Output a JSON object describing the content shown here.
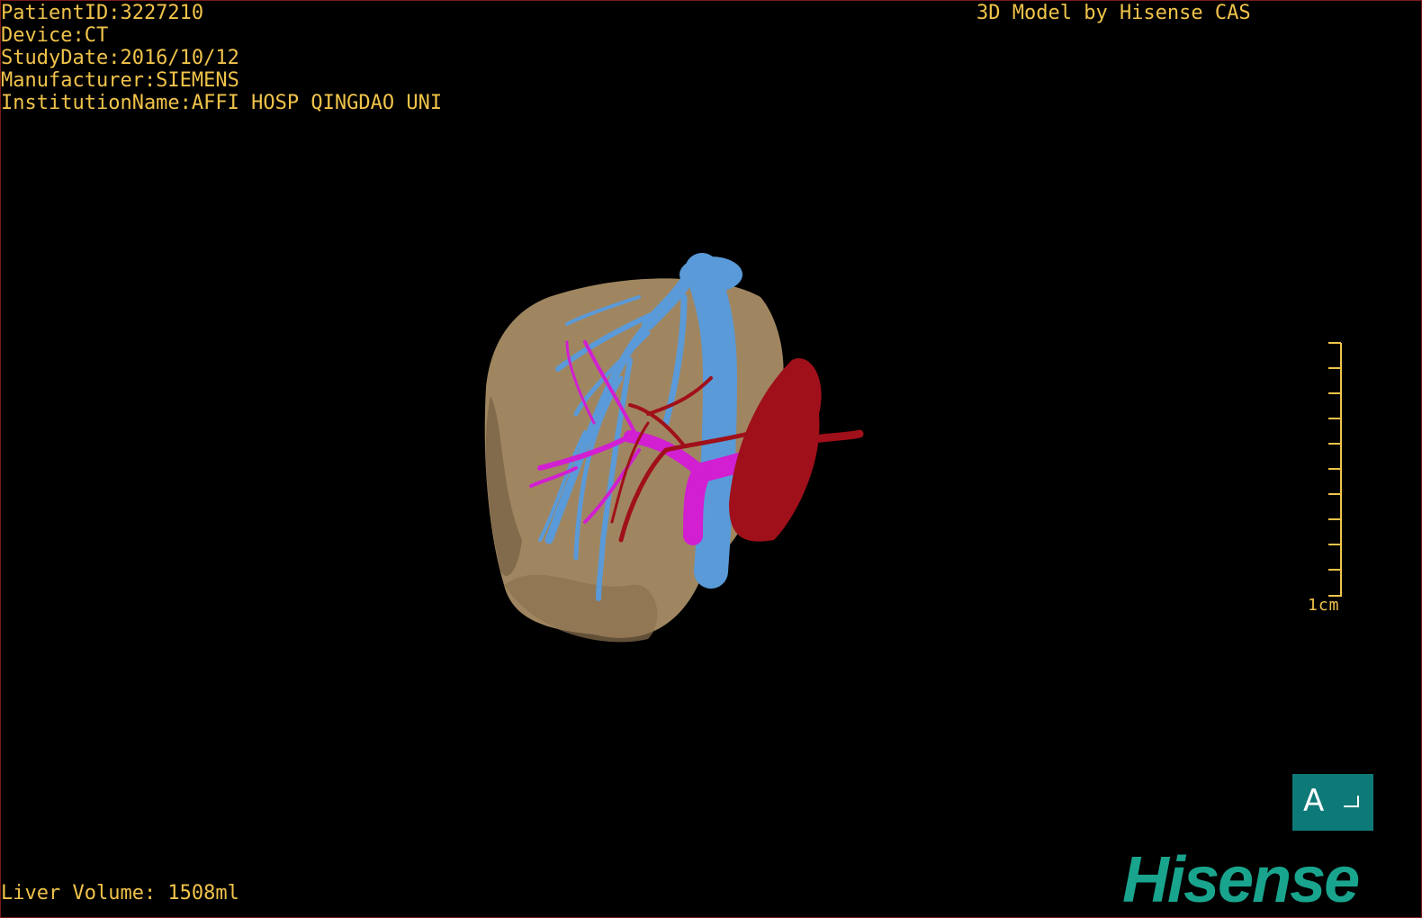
{
  "header": {
    "patient_id": "PatientID:3227210",
    "device": "Device:CT",
    "study_date": "StudyDate:2016/10/12",
    "manufacturer": "Manufacturer:SIEMENS",
    "institution": "InstitutionName:AFFI HOSP QINGDAO UNI"
  },
  "model_credit": "3D Model by Hisense CAS",
  "footer": {
    "liver_volume": "Liver Volume: 1508ml"
  },
  "scale": {
    "label": "1cm"
  },
  "orientation": {
    "label": "A"
  },
  "brand": "Hisense",
  "colors": {
    "overlay_text": "#f0c34a",
    "liver": "#a08660",
    "hepatic_vein": "#5a9ad8",
    "portal_vein": "#d11fd1",
    "artery": "#a0101a",
    "orientation_box": "#0e7a78",
    "brand": "#19a48e"
  }
}
